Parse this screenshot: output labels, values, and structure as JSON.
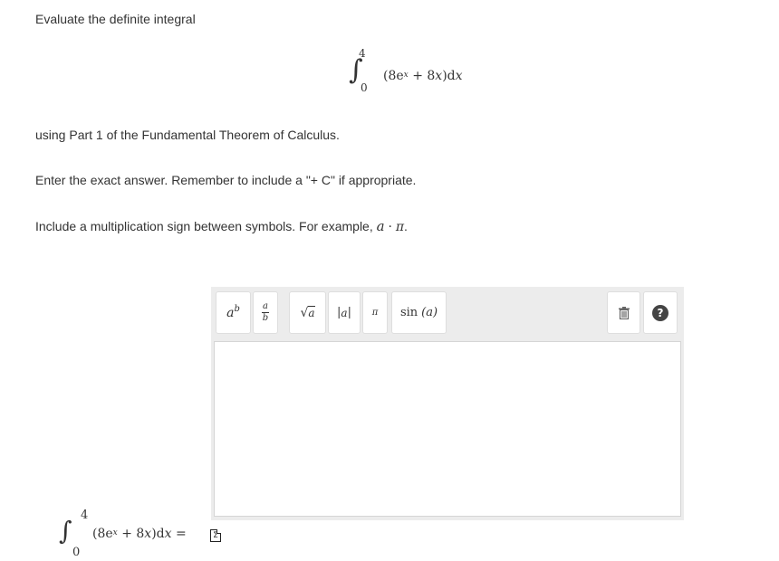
{
  "question": {
    "intro": "Evaluate the definite integral",
    "instruction_1": "using Part 1 of the Fundamental Theorem of Calculus.",
    "instruction_2": "Enter the exact answer. Remember to include a \"+ C\" if appropriate.",
    "instruction_3_prefix": "Include a multiplication sign between symbols. For example, ",
    "instruction_3_example_a": "a",
    "instruction_3_example_dot": "·",
    "instruction_3_example_pi": "π",
    "instruction_3_suffix": "."
  },
  "integral": {
    "sign": "∫",
    "upper": "4",
    "lower": "0",
    "open": "(8e",
    "exp": "x",
    "rest": "+ 8",
    "var": "x",
    "close": ")d",
    "dvar": "x",
    "equals": "="
  },
  "toolbar": {
    "power": {
      "base": "a",
      "exp": "b"
    },
    "fraction": {
      "num": "a",
      "den": "b"
    },
    "sqrt": {
      "radical": "√",
      "arg": "a"
    },
    "abs": {
      "bar": "|",
      "arg": "a"
    },
    "pi": "π",
    "sin": {
      "name": "sin",
      "arg": "(a)"
    },
    "help": "?"
  },
  "equation_icon": "Σ",
  "colors": {
    "text": "#333333",
    "editor_bg": "#ececec",
    "button_border": "#dedede",
    "help_bg": "#444444"
  },
  "icons": [
    "trash-icon",
    "help-icon",
    "equation-editor-icon"
  ]
}
